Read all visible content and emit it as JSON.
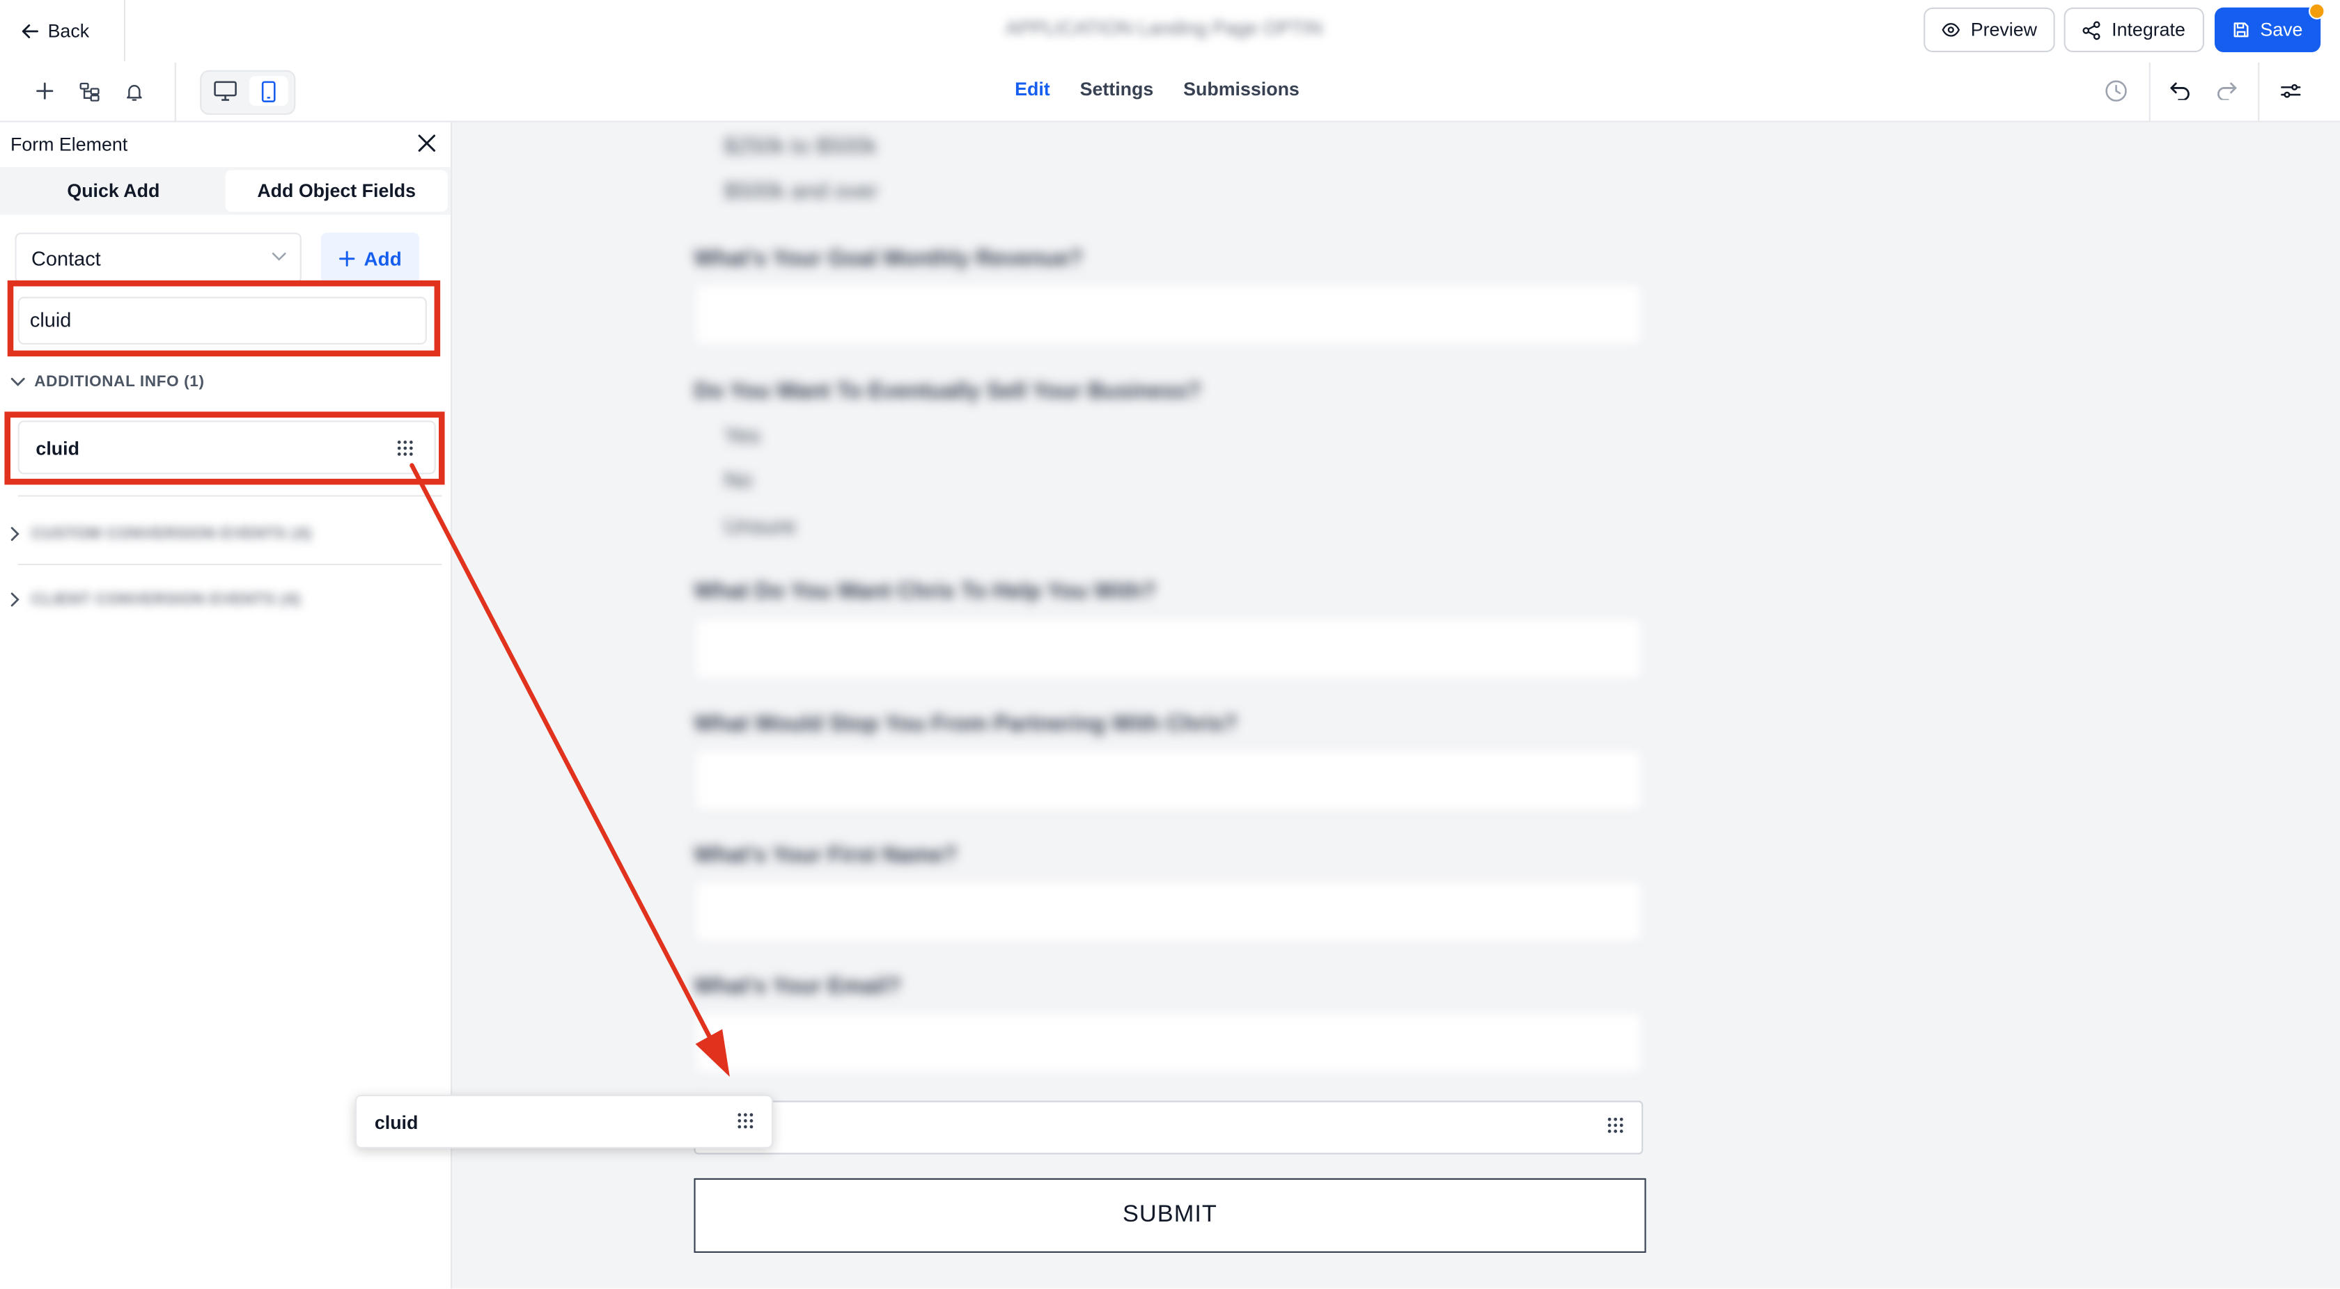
{
  "header": {
    "back_label": "Back",
    "doc_title": "APPLICATION Landing Page OPTIN",
    "preview_label": "Preview",
    "integrate_label": "Integrate",
    "save_label": "Save"
  },
  "toolbar": {
    "tabs": [
      {
        "label": "Edit",
        "active": true
      },
      {
        "label": "Settings",
        "active": false
      },
      {
        "label": "Submissions",
        "active": false
      }
    ]
  },
  "panel": {
    "title": "Form Element",
    "tabs": [
      {
        "label": "Quick Add",
        "active": false
      },
      {
        "label": "Add Object Fields",
        "active": true
      }
    ],
    "object_select": "Contact",
    "add_label": "Add",
    "search_value": "cluid",
    "group_label": "ADDITIONAL INFO (1)",
    "group_items": [
      "cluid"
    ],
    "collapsed_groups": [
      "CUSTOM CONVERSION EVENTS (4)",
      "CLIENT CONVERSION EVENTS (4)"
    ]
  },
  "form": {
    "options_top": [
      "$250k to $500k",
      "$500k and over"
    ],
    "q1": "What's Your Goal Monthly Revenue?",
    "q2": "Do You Want To Eventually Sell Your Business?",
    "q2_options": [
      "Yes",
      "No",
      "Unsure"
    ],
    "q3": "What Do You Want Chris To Help You With?",
    "q4": "What Would Stop You From Partnering With Chris?",
    "q5": "What's Your First Name?",
    "q6": "What's Your Email?",
    "drop_ghost": "cluid",
    "submit_label": "SUBMIT"
  },
  "drag": {
    "label": "cluid"
  },
  "colors": {
    "accent": "#155eef",
    "annotation": "#e0321d",
    "badge": "#f59e0b"
  }
}
